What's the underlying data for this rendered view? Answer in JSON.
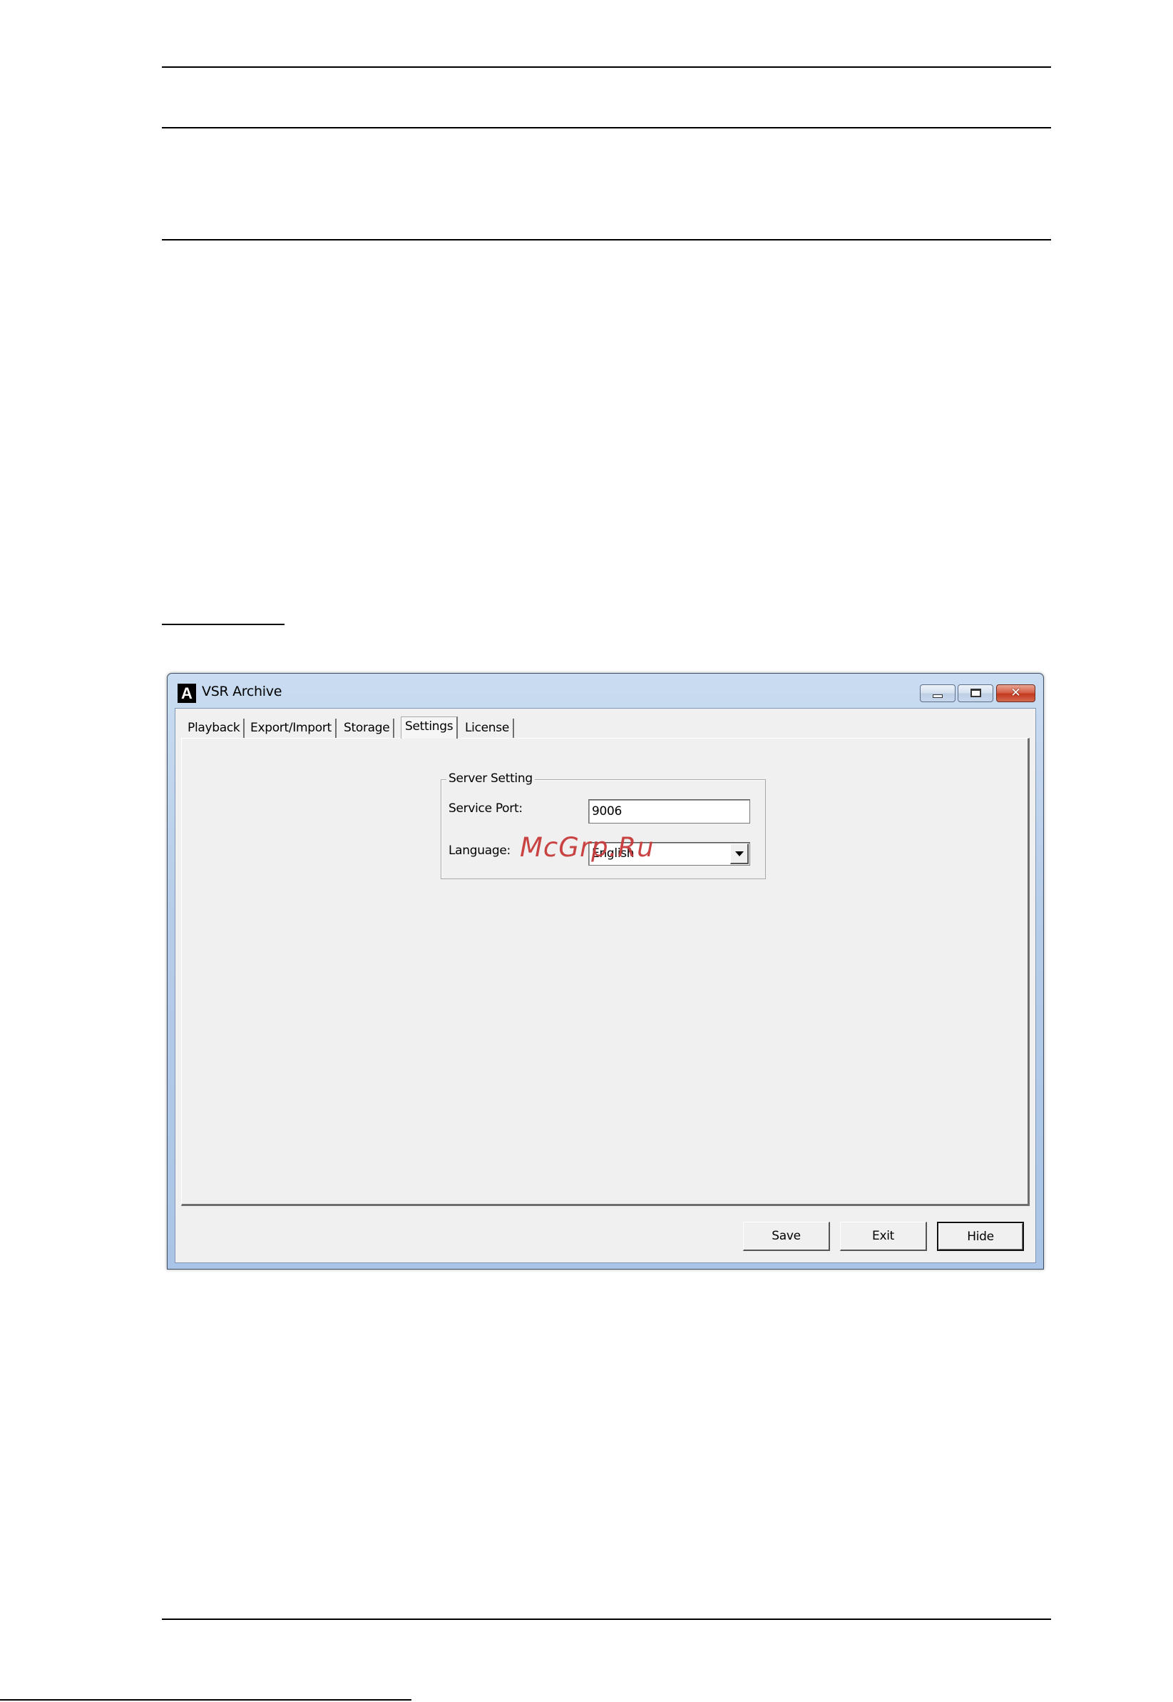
{
  "window": {
    "title": "VSR Archive",
    "icon_letter": "A"
  },
  "tabs": [
    {
      "label": "Playback"
    },
    {
      "label": "Export/Import"
    },
    {
      "label": "Storage"
    },
    {
      "label": "Settings",
      "active": true
    },
    {
      "label": "License"
    }
  ],
  "server_setting": {
    "title": "Server Setting",
    "service_port_label": "Service Port:",
    "service_port_value": "9006",
    "language_label": "Language:",
    "language_value": "English"
  },
  "buttons": {
    "save": "Save",
    "exit": "Exit",
    "hide": "Hide"
  },
  "watermark": "McGrp.Ru",
  "colors": {
    "window_frame": "#b6cde9",
    "client_bg": "#f0f0f0",
    "close_button": "#c4391f",
    "watermark": "#c73a3a"
  }
}
